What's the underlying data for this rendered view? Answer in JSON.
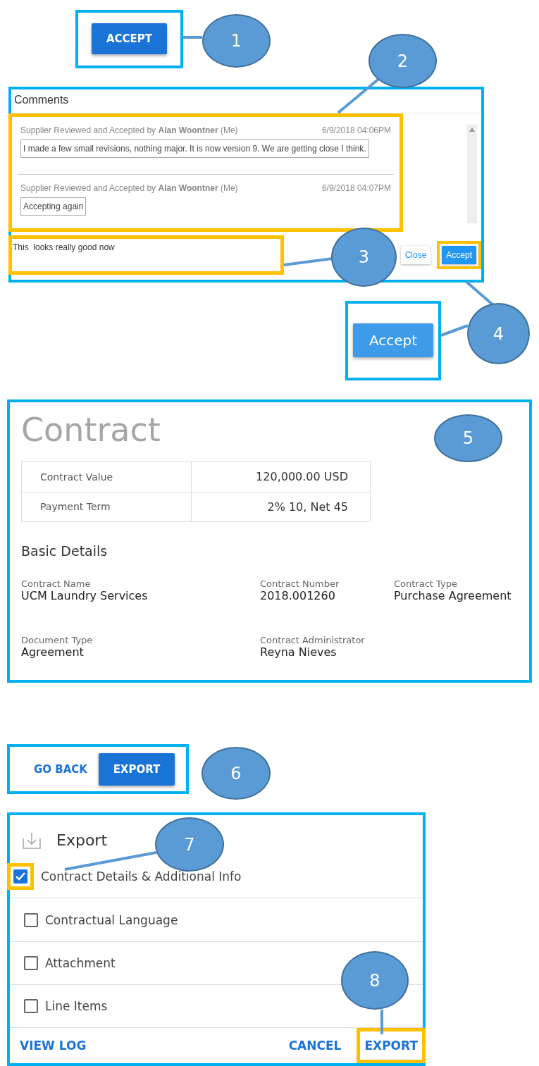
{
  "accept_button": {
    "label": "ACCEPT"
  },
  "comments_panel": {
    "title": "Comments",
    "comments": [
      {
        "header": "Supplier Reviewed and Accepted by **Alan Woontner** (Me)",
        "timestamp": "6/9/2018 04:06PM",
        "body": "I made a few small revisions, nothing major. It is now version 9. We are getting close I think."
      },
      {
        "header": "Supplier Reviewed and Accepted by **Alan Woontner** (Me)",
        "timestamp": "6/9/2018 04:07PM",
        "body": "Accepting again"
      }
    ],
    "input": {
      "value": "This  looks really good now"
    },
    "buttons": [
      {
        "label": "Close",
        "kind": "secondary"
      },
      {
        "label": "Accept",
        "kind": "primary"
      }
    ]
  },
  "large_accept_button": {
    "label": "Accept"
  },
  "contract": {
    "title": "Contract",
    "summary": [
      {
        "label": "Contract Value",
        "value": "120,000.00 USD"
      },
      {
        "label": "Payment Term",
        "value": "2% 10, Net 45"
      }
    ],
    "section_title": "Basic Details",
    "fields": [
      {
        "label": "Contract Name",
        "value": "UCM Laundry Services"
      },
      {
        "label": "Contract Number",
        "value": "2018.001260"
      },
      {
        "label": "Contract Type",
        "value": "Purchase Agreement"
      },
      {
        "label": "Document Type",
        "value": "Agreement"
      },
      {
        "label": "Contract Administrator",
        "value": "Reyna Nieves"
      }
    ]
  },
  "export_actions": [
    {
      "label": "GO BACK",
      "kind": "text"
    },
    {
      "label": "EXPORT",
      "kind": "primary"
    }
  ],
  "export_panel": {
    "title": "Export",
    "options": [
      {
        "label": "Contract Details & Additional Info",
        "checked": true
      },
      {
        "label": "Contractual Language",
        "checked": false
      },
      {
        "label": "Attachment",
        "checked": false
      },
      {
        "label": "Line Items",
        "checked": false
      }
    ],
    "footer": [
      {
        "label": "VIEW LOG",
        "kind": "left"
      },
      {
        "label": "CANCEL",
        "kind": "right"
      },
      {
        "label": "EXPORT",
        "kind": "right"
      }
    ]
  },
  "callouts": [
    {
      "number": "1"
    },
    {
      "number": "2"
    },
    {
      "number": "3"
    },
    {
      "number": "4"
    },
    {
      "number": "5"
    },
    {
      "number": "6"
    },
    {
      "number": "7"
    },
    {
      "number": "8"
    }
  ]
}
